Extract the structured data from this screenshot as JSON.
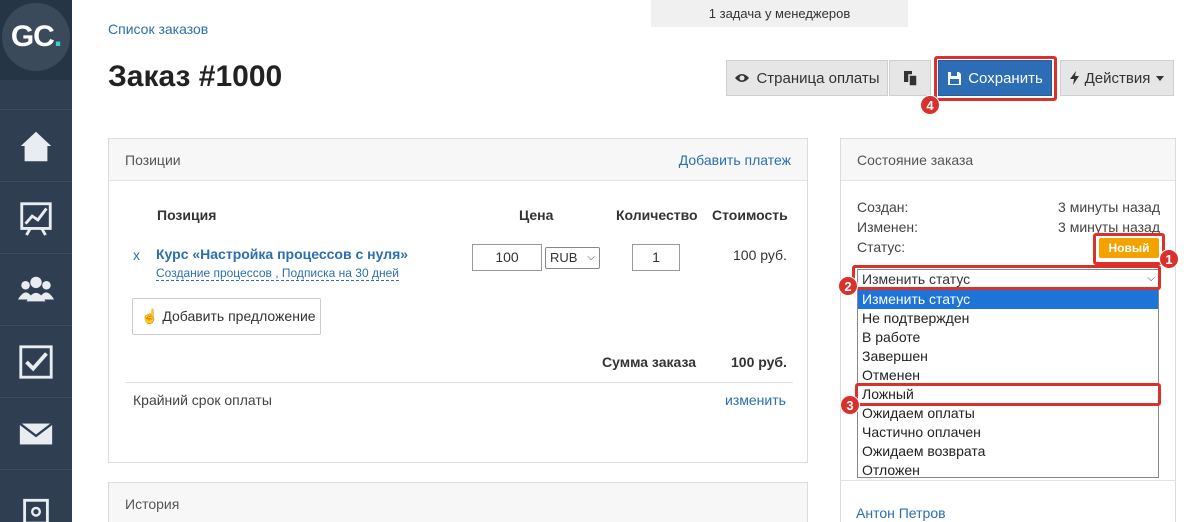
{
  "logo": {
    "text": "GC",
    "dot": "."
  },
  "sidebar": {
    "items": [
      {
        "name": "home-icon"
      },
      {
        "name": "chart-icon"
      },
      {
        "name": "users-icon"
      },
      {
        "name": "tasks-icon"
      },
      {
        "name": "mail-icon"
      },
      {
        "name": "settings-icon"
      }
    ]
  },
  "top_notice": "1 задача у менеджеров",
  "breadcrumb": "Список заказов",
  "page_title": "Заказ #1000",
  "toolbar": {
    "payment_page": "Страница оплаты",
    "save": "Сохранить",
    "actions": "Действия"
  },
  "positions": {
    "title": "Позиции",
    "add_payment": "Добавить платеж",
    "headers": {
      "item": "Позиция",
      "price": "Цена",
      "qty": "Количество",
      "cost": "Стоимость"
    },
    "row": {
      "remove": "x",
      "title": "Курс «Настройка процессов с нуля»",
      "subtitle": "Создание процессов , Подписка на 30 дней",
      "price": "100",
      "currency": "RUB",
      "qty": "1",
      "cost": "100 руб."
    },
    "add_offer": "Добавить предложение",
    "sum_label": "Сумма заказа",
    "sum_value": "100 руб.",
    "deadline_label": "Крайний срок оплаты",
    "deadline_link": "изменить"
  },
  "history": {
    "title": "История"
  },
  "state": {
    "title": "Состояние заказа",
    "created_label": "Создан:",
    "created_value": "3 минуты назад",
    "changed_label": "Изменен:",
    "changed_value": "3 минуты назад",
    "status_label": "Статус:",
    "status_value": "Новый",
    "status_select": "Изменить статус",
    "options": [
      "Изменить статус",
      "Не подтвержден",
      "В работе",
      "Завершен",
      "Отменен",
      "Ложный",
      "Ожидаем оплаты",
      "Частично оплачен",
      "Ожидаем возврата",
      "Отложен"
    ]
  },
  "person": "Антон Петров",
  "callouts": [
    "1",
    "2",
    "3",
    "4"
  ],
  "colors": {
    "accent": "#2d6db5",
    "callout": "#d9322c",
    "status_new": "#f3a200",
    "sidebar": "#2f3f51"
  }
}
